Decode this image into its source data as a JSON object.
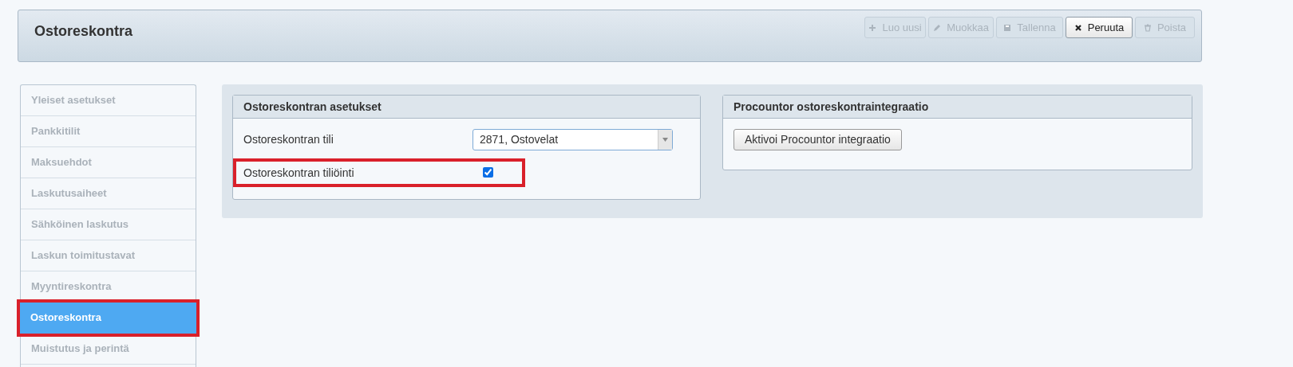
{
  "header": {
    "title": "Ostoreskontra",
    "buttons": [
      {
        "label": "Luo uusi",
        "kind": "plus",
        "disabled": true
      },
      {
        "label": "Muokkaa",
        "kind": "pencil",
        "disabled": true
      },
      {
        "label": "Tallenna",
        "kind": "save",
        "disabled": true
      },
      {
        "label": "Peruuta",
        "kind": "close",
        "disabled": false
      },
      {
        "label": "Poista",
        "kind": "trash",
        "disabled": true
      }
    ]
  },
  "sidebar": {
    "items": [
      {
        "label": "Yleiset asetukset",
        "selected": false,
        "highlighted": false
      },
      {
        "label": "Pankkitilit",
        "selected": false,
        "highlighted": false
      },
      {
        "label": "Maksuehdot",
        "selected": false,
        "highlighted": false
      },
      {
        "label": "Laskutusaiheet",
        "selected": false,
        "highlighted": false
      },
      {
        "label": "Sähköinen laskutus",
        "selected": false,
        "highlighted": false
      },
      {
        "label": "Laskun toimitustavat",
        "selected": false,
        "highlighted": false
      },
      {
        "label": "Myyntireskontra",
        "selected": false,
        "highlighted": false
      },
      {
        "label": "Ostoreskontra",
        "selected": true,
        "highlighted": true
      },
      {
        "label": "Muistutus ja perintä",
        "selected": false,
        "highlighted": false
      }
    ]
  },
  "settings_card": {
    "title": "Ostoreskontran asetukset",
    "fields": [
      {
        "kind": "select",
        "label": "Ostoreskontran tili",
        "value": "2871, Ostovelat",
        "highlighted": false
      },
      {
        "kind": "checkbox",
        "label": "Ostoreskontran tiliöinti",
        "checked": true,
        "highlighted": true
      }
    ]
  },
  "integration_card": {
    "title": "Procountor ostoreskontraintegraatio",
    "button": "Aktivoi Procountor integraatio"
  }
}
